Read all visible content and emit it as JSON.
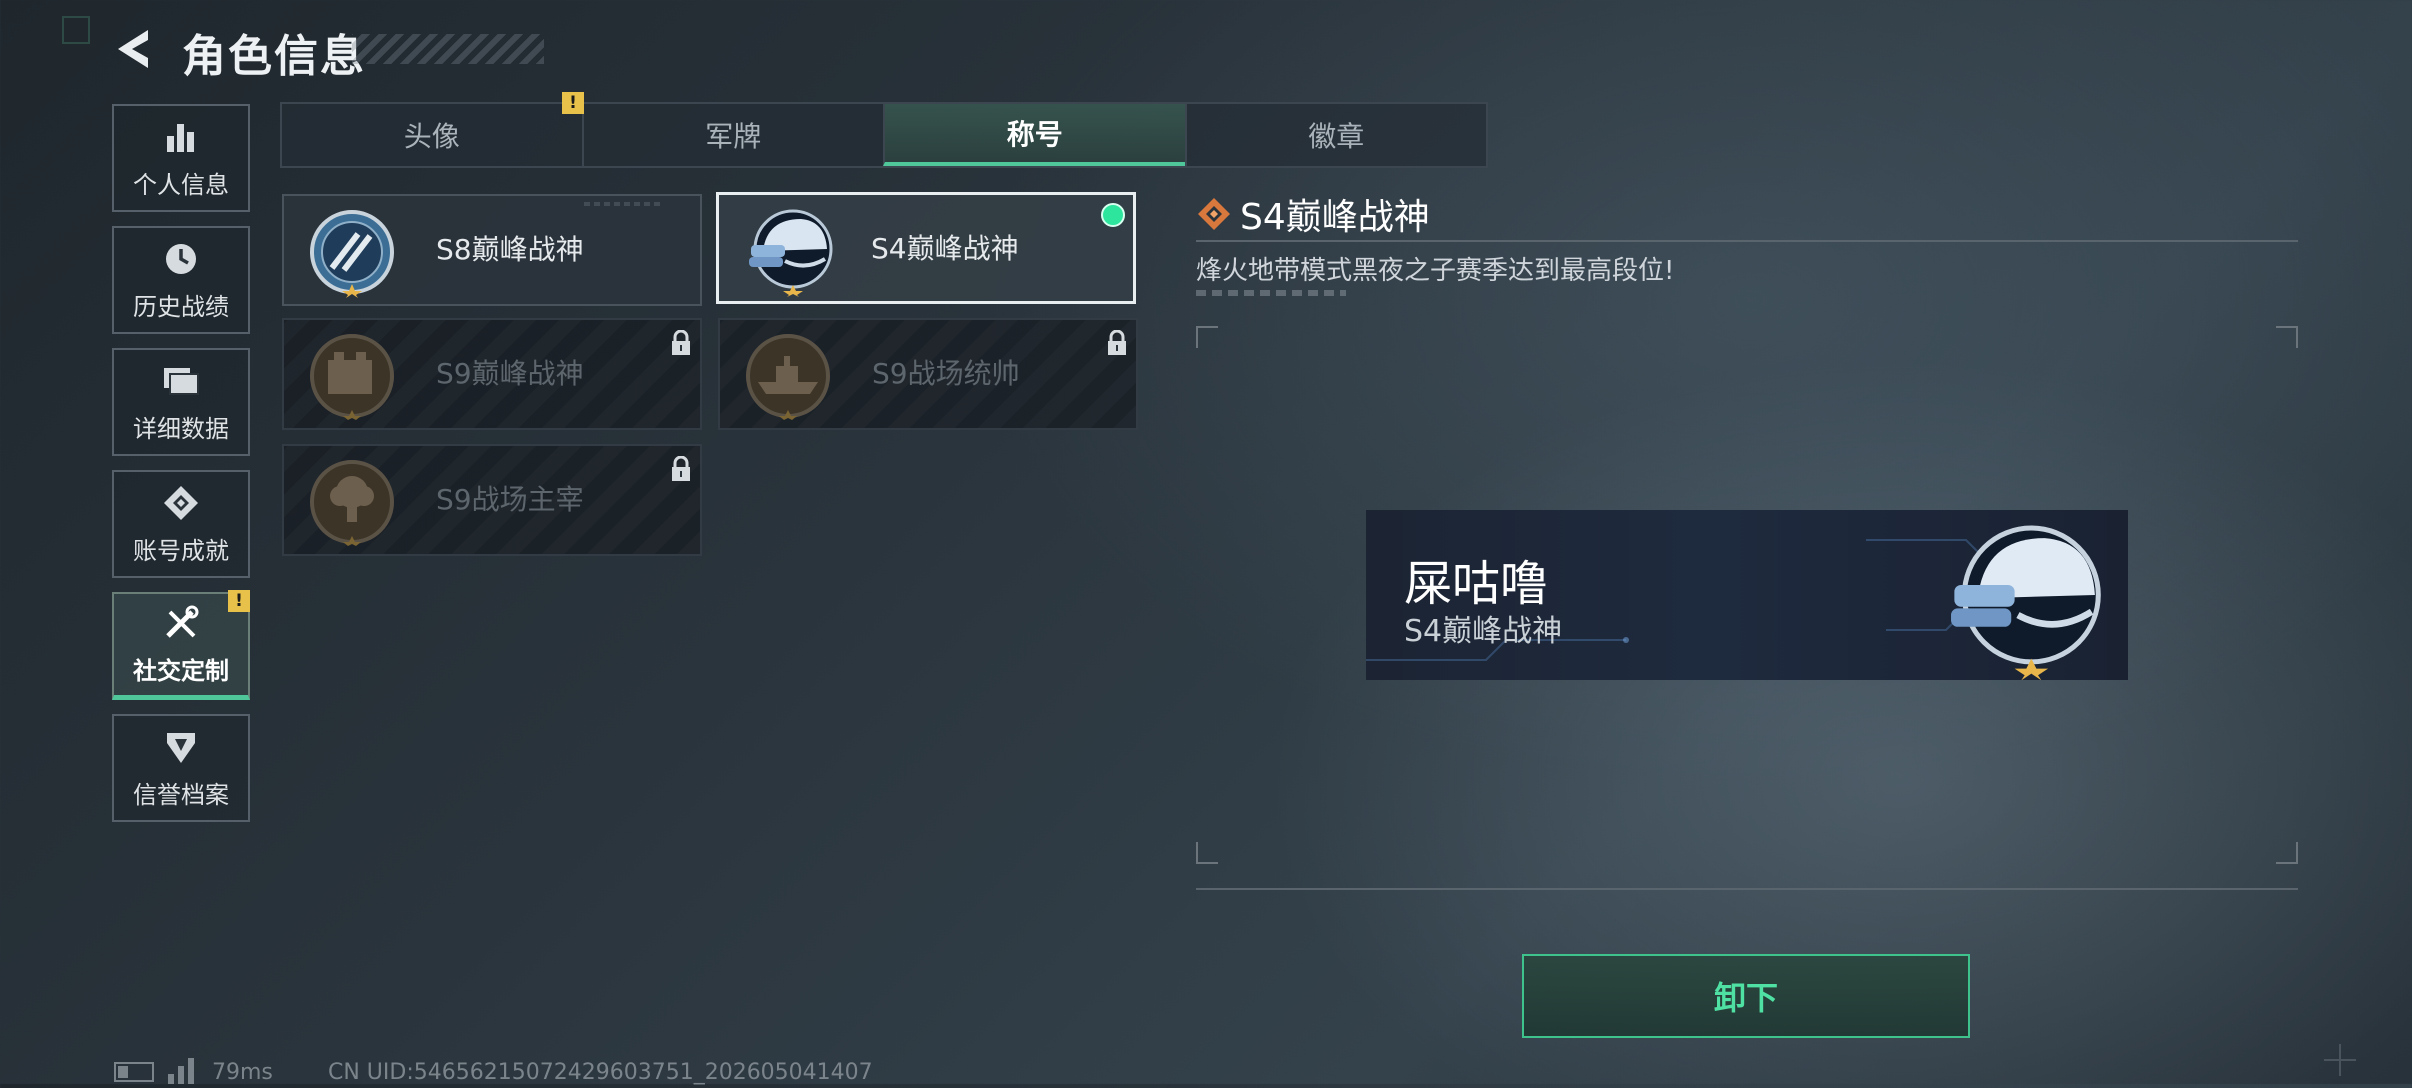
{
  "header": {
    "title": "角色信息"
  },
  "sidebar": {
    "items": [
      {
        "label": "个人信息",
        "icon": "bar-chart-icon"
      },
      {
        "label": "历史战绩",
        "icon": "clock-icon"
      },
      {
        "label": "详细数据",
        "icon": "folder-icon"
      },
      {
        "label": "账号成就",
        "icon": "achievement-icon"
      },
      {
        "label": "社交定制",
        "icon": "tools-icon",
        "active": true,
        "badge": "!"
      },
      {
        "label": "信誉档案",
        "icon": "shield-icon"
      }
    ]
  },
  "tabs": [
    {
      "label": "头像",
      "badge": "!"
    },
    {
      "label": "军牌"
    },
    {
      "label": "称号",
      "active": true
    },
    {
      "label": "徽章"
    }
  ],
  "titles": [
    {
      "name": "S8巅峰战神",
      "state": "owned"
    },
    {
      "name": "S4巅峰战神",
      "state": "equipped"
    },
    {
      "name": "S9巅峰战神",
      "state": "locked"
    },
    {
      "name": "S9战场统帅",
      "state": "locked"
    },
    {
      "name": "S9战场主宰",
      "state": "locked"
    }
  ],
  "detail": {
    "title": "S4巅峰战神",
    "description": "烽火地带模式黑夜之子赛季达到最高段位!"
  },
  "preview": {
    "player_name": "屎咕噜",
    "title": "S4巅峰战神"
  },
  "actions": {
    "unequip_label": "卸下"
  },
  "status": {
    "ping": "79ms",
    "uid": "CN UID:54656215072429603751_202605041407"
  },
  "colors": {
    "accent": "#4fc79a",
    "equipped_dot": "#2ee59d",
    "warning": "#e7c14a",
    "detail_diamond": "#d9783c"
  }
}
